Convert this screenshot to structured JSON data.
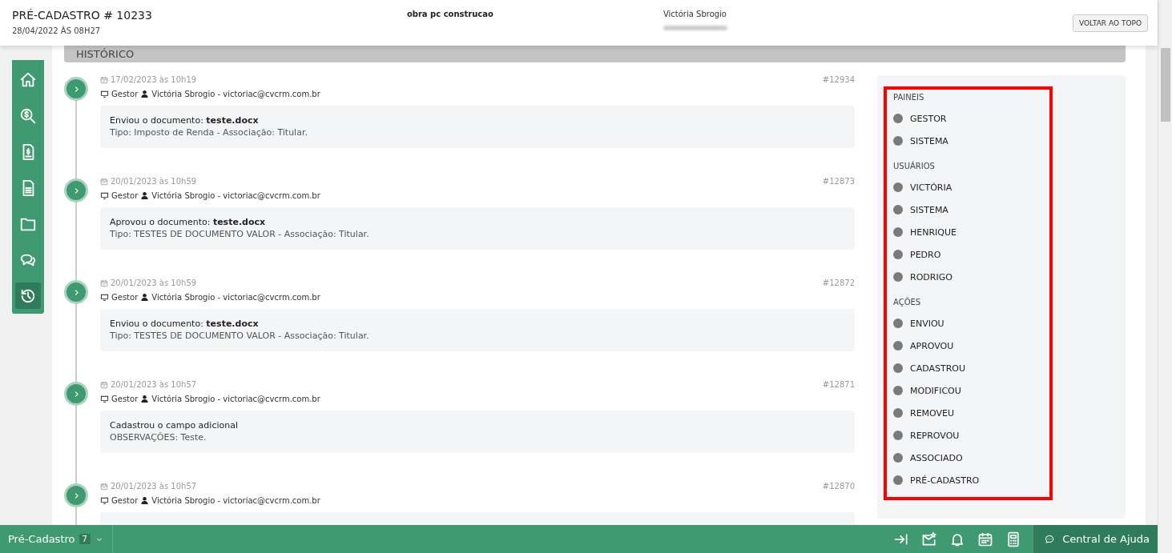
{
  "header": {
    "title": "PRÉ-CADASTRO # 10233",
    "date": "28/04/2022 ÀS 08H27",
    "project": "obra pc construcao",
    "user_name": "Victória Sbrogio",
    "button": "VOLTAR AO TOPO"
  },
  "section_title": "HISTÓRICO",
  "side_nav": [
    {
      "kind": "home",
      "selected": false
    },
    {
      "kind": "money-search",
      "selected": false
    },
    {
      "kind": "invoice",
      "selected": false
    },
    {
      "kind": "document",
      "selected": false
    },
    {
      "kind": "folder",
      "selected": false
    },
    {
      "kind": "chat",
      "selected": false
    },
    {
      "kind": "history",
      "selected": true
    }
  ],
  "timeline": [
    {
      "date": "17/02/2023 às 10h19",
      "panel": "Gestor",
      "user": "Victória Sbrogio - victoriac@cvcrm.com.br",
      "id": "#12934",
      "lines": [
        "Enviou o documento: **teste.docx**",
        "Tipo: Imposto de Renda - Associação: Titular."
      ]
    },
    {
      "date": "20/01/2023 às 10h59",
      "panel": "Gestor",
      "user": "Victória Sbrogio - victoriac@cvcrm.com.br",
      "id": "#12873",
      "lines": [
        "Aprovou o documento: **teste.docx**",
        "Tipo: TESTES DE DOCUMENTO VALOR - Associação: Titular."
      ]
    },
    {
      "date": "20/01/2023 às 10h59",
      "panel": "Gestor",
      "user": "Victória Sbrogio - victoriac@cvcrm.com.br",
      "id": "#12872",
      "lines": [
        "Enviou o documento: **teste.docx**",
        "Tipo: TESTES DE DOCUMENTO VALOR - Associação: Titular."
      ]
    },
    {
      "date": "20/01/2023 às 10h57",
      "panel": "Gestor",
      "user": "Victória Sbrogio - victoriac@cvcrm.com.br",
      "id": "#12871",
      "lines": [
        "Cadastrou o campo adicional",
        "OBSERVAÇÕES: Teste."
      ]
    },
    {
      "date": "20/01/2023 às 10h57",
      "panel": "Gestor",
      "user": "Victória Sbrogio - victoriac@cvcrm.com.br",
      "id": "#12870"
    }
  ],
  "filters": [
    {
      "title": "PAINEIS",
      "items": [
        {
          "label": "GESTOR"
        },
        {
          "label": "SISTEMA"
        }
      ]
    },
    {
      "title": "USUÁRIOS",
      "items": [
        {
          "label": "VICTÓRIA"
        },
        {
          "label": "SISTEMA"
        },
        {
          "label": "HENRIQUE"
        },
        {
          "label": "PEDRO"
        },
        {
          "label": "RODRIGO"
        }
      ]
    },
    {
      "title": "AÇÕES",
      "items": [
        {
          "label": "ENVIOU"
        },
        {
          "label": "APROVOU"
        },
        {
          "label": "CADASTROU"
        },
        {
          "label": "MODIFICOU"
        },
        {
          "label": "REMOVEU"
        },
        {
          "label": "REPROVOU"
        },
        {
          "label": "ASSOCIADO"
        },
        {
          "label": "PRÉ-CADASTRO"
        }
      ]
    }
  ],
  "footer": {
    "module": "Pré-Cadastro",
    "count": "7",
    "tools": [
      {
        "kind": "collapse"
      },
      {
        "kind": "mail"
      },
      {
        "kind": "bell"
      },
      {
        "kind": "calendar"
      },
      {
        "kind": "calculator"
      }
    ],
    "help": "Central de Ajuda"
  }
}
